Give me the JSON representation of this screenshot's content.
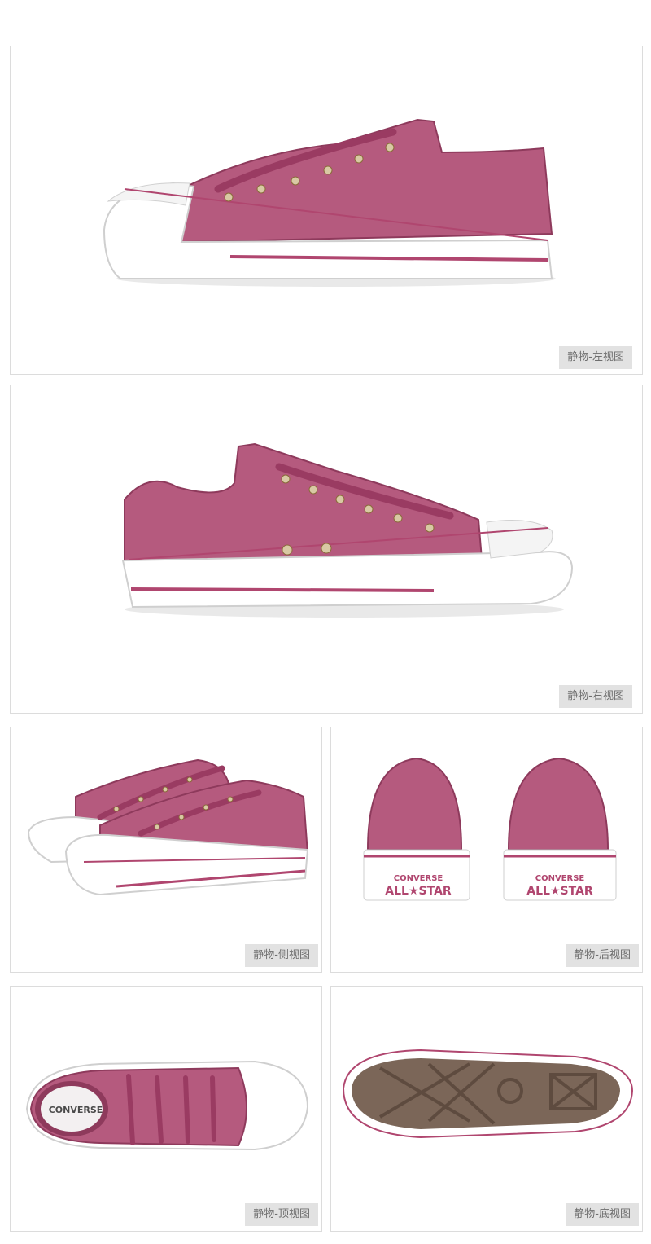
{
  "colors": {
    "upper": "#b55a7e",
    "upper_dark": "#8e3a5c",
    "sole": "#ffffff",
    "stripe": "#b0466f",
    "outsole": "#7b6658",
    "eyelet": "#d9c9a4"
  },
  "views": [
    {
      "id": "left",
      "label": "静物-左视图"
    },
    {
      "id": "right",
      "label": "静物-右视图"
    },
    {
      "id": "side",
      "label": "静物-侧视图"
    },
    {
      "id": "back",
      "label": "静物-后视图"
    },
    {
      "id": "top",
      "label": "静物-顶视图"
    },
    {
      "id": "bottom",
      "label": "静物-底视图"
    }
  ],
  "brand": {
    "name": "CONVERSE",
    "line": "ALL★STAR"
  }
}
